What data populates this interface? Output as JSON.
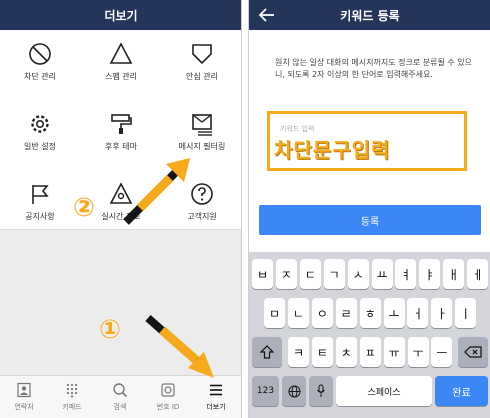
{
  "left_screen": {
    "title": "더보기",
    "menu": [
      {
        "label": "차단 관리",
        "icon": "block-icon"
      },
      {
        "label": "스팸 관리",
        "icon": "triangle-icon"
      },
      {
        "label": "안심 관리",
        "icon": "shield-icon"
      },
      {
        "label": "일반 설정",
        "icon": "gear-icon"
      },
      {
        "label": "후후 테마",
        "icon": "paint-roller-icon"
      },
      {
        "label": "메시지 필터링",
        "icon": "message-filter-icon"
      },
      {
        "label": "공지사항",
        "icon": "flag-icon"
      },
      {
        "label": "실시간 제보",
        "icon": "report-icon"
      },
      {
        "label": "고객지원",
        "icon": "help-icon"
      }
    ],
    "tabs": [
      {
        "label": "연락처",
        "icon": "contacts-icon"
      },
      {
        "label": "키패드",
        "icon": "keypad-icon"
      },
      {
        "label": "검색",
        "icon": "search-icon"
      },
      {
        "label": "번호 ID",
        "icon": "number-id-icon"
      },
      {
        "label": "더보기",
        "icon": "menu-icon"
      }
    ],
    "step_badges": {
      "one": "①",
      "two": "②"
    }
  },
  "right_screen": {
    "title": "키워드 등록",
    "description": "원치 않는 일상 대화의 메시지까지도 정크로 분류될 수 있으니, 되도록 2자 이상의 한 단어로 입력해주세요.",
    "keyword_input": {
      "placeholder": "키워드 입력",
      "value": "차단문구입력"
    },
    "register_label": "등록",
    "keyboard": {
      "row1": [
        "ㅂ",
        "ㅈ",
        "ㄷ",
        "ㄱ",
        "ㅅ",
        "ㅛ",
        "ㅕ",
        "ㅑ",
        "ㅐ",
        "ㅔ"
      ],
      "row2": [
        "ㅁ",
        "ㄴ",
        "ㅇ",
        "ㄹ",
        "ㅎ",
        "ㅗ",
        "ㅓ",
        "ㅏ",
        "ㅣ"
      ],
      "row3": [
        "ㅋ",
        "ㅌ",
        "ㅊ",
        "ㅍ",
        "ㅠ",
        "ㅜ",
        "ㅡ"
      ],
      "numbers_label": "123",
      "space_label": "스페이스",
      "done_label": "완료"
    }
  },
  "colors": {
    "header": "#24345a",
    "accent": "#f6a91b",
    "button": "#3b87f5"
  }
}
